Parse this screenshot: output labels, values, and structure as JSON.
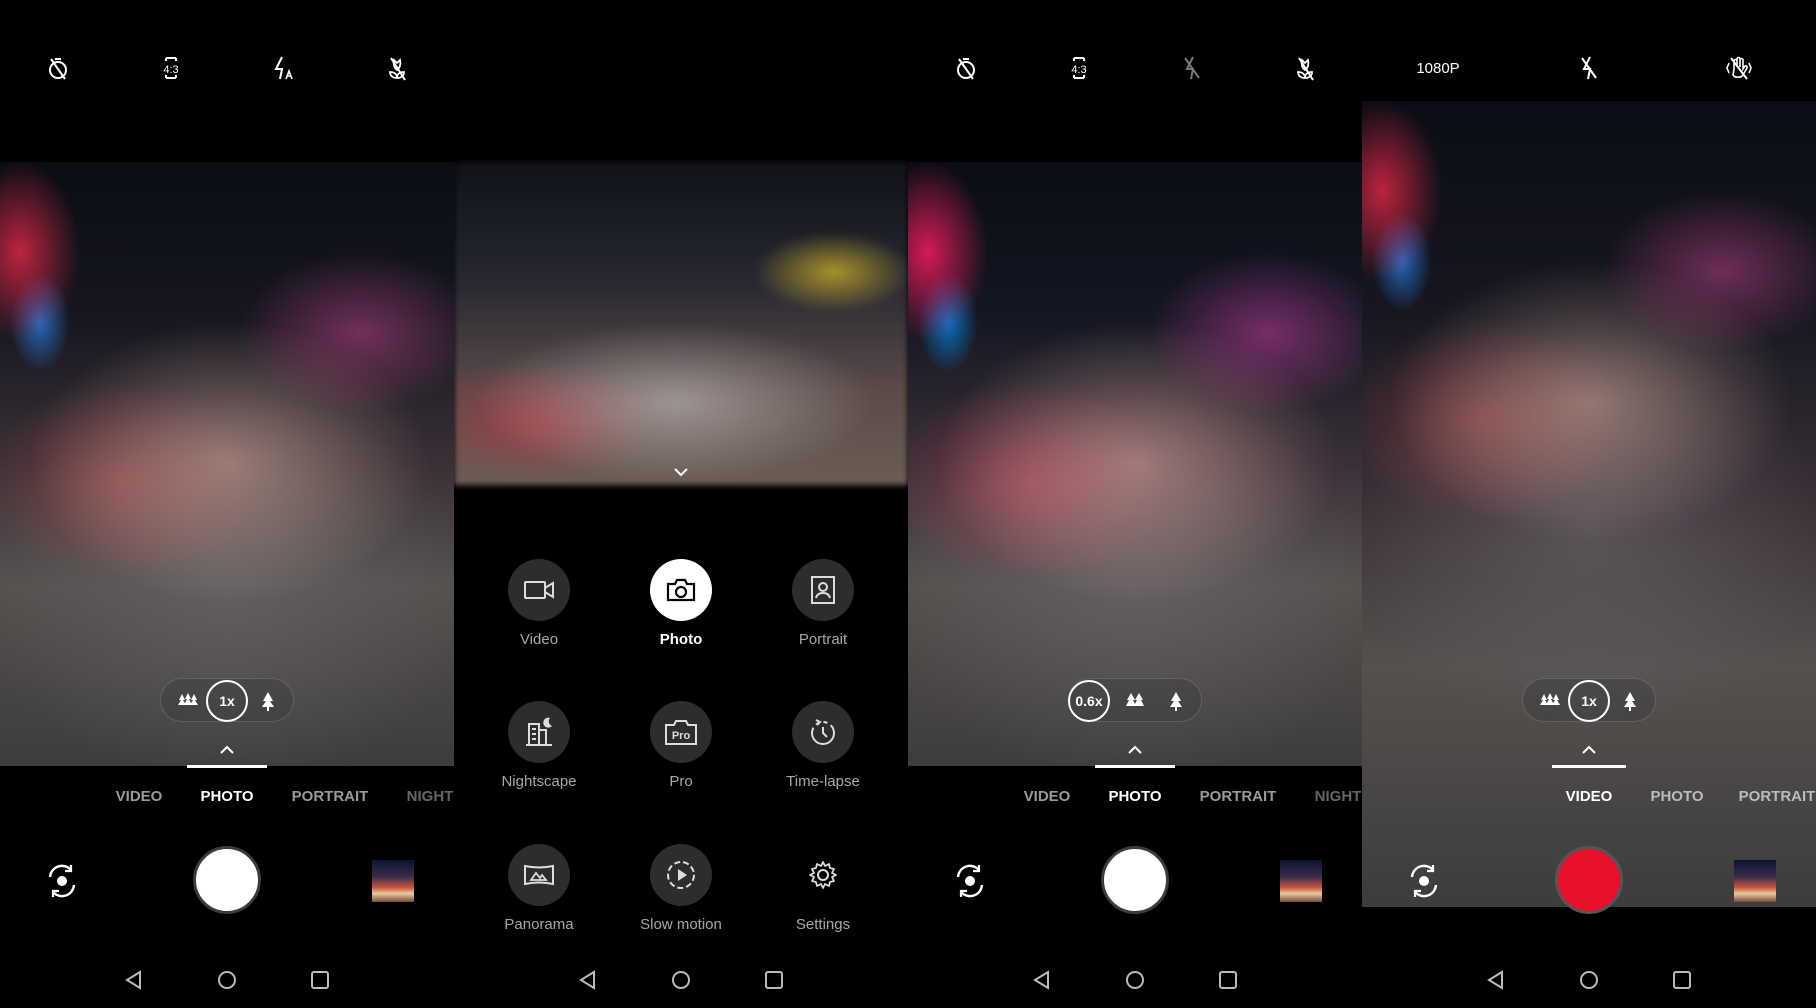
{
  "colors": {
    "record": "#e8102a",
    "background": "#000000",
    "inactive_text": "#9a9a9a"
  },
  "panel1": {
    "topbar": {
      "icons": [
        "timer-off-icon",
        "aspect-ratio-icon",
        "flash-auto-icon",
        "macro-off-icon"
      ],
      "aspect_label": "4:3"
    },
    "zoom": {
      "selected": "1x",
      "options": [
        "wide",
        "1x",
        "tele"
      ]
    },
    "modes": [
      "VIDEO",
      "PHOTO",
      "PORTRAIT",
      "NIGHT"
    ],
    "active_mode": "PHOTO"
  },
  "panel2": {
    "menu": [
      {
        "label": "Video",
        "icon": "video-icon"
      },
      {
        "label": "Photo",
        "icon": "camera-icon",
        "selected": true
      },
      {
        "label": "Portrait",
        "icon": "portrait-icon"
      },
      {
        "label": "Nightscape",
        "icon": "nightscape-icon"
      },
      {
        "label": "Pro",
        "icon": "pro-camera-icon"
      },
      {
        "label": "Time-lapse",
        "icon": "time-lapse-icon"
      },
      {
        "label": "Panorama",
        "icon": "panorama-icon"
      },
      {
        "label": "Slow motion",
        "icon": "slow-motion-icon"
      },
      {
        "label": "Settings",
        "icon": "gear-icon"
      }
    ],
    "pro_label": "Pro"
  },
  "panel3": {
    "topbar": {
      "icons": [
        "timer-off-icon",
        "aspect-ratio-icon",
        "flash-off-icon",
        "macro-off-icon"
      ],
      "aspect_label": "4:3"
    },
    "zoom": {
      "selected": "0.6x",
      "options": [
        "0.6x",
        "wide",
        "tele"
      ]
    },
    "modes": [
      "VIDEO",
      "PHOTO",
      "PORTRAIT",
      "NIGHT"
    ],
    "active_mode": "PHOTO"
  },
  "panel4": {
    "topbar": {
      "resolution": "1080P",
      "icons": [
        "flash-off-icon",
        "stabilization-off-icon"
      ]
    },
    "zoom": {
      "selected": "1x",
      "options": [
        "wide",
        "1x",
        "tele"
      ]
    },
    "modes": [
      "VIDEO",
      "PHOTO",
      "PORTRAIT"
    ],
    "active_mode": "VIDEO"
  }
}
